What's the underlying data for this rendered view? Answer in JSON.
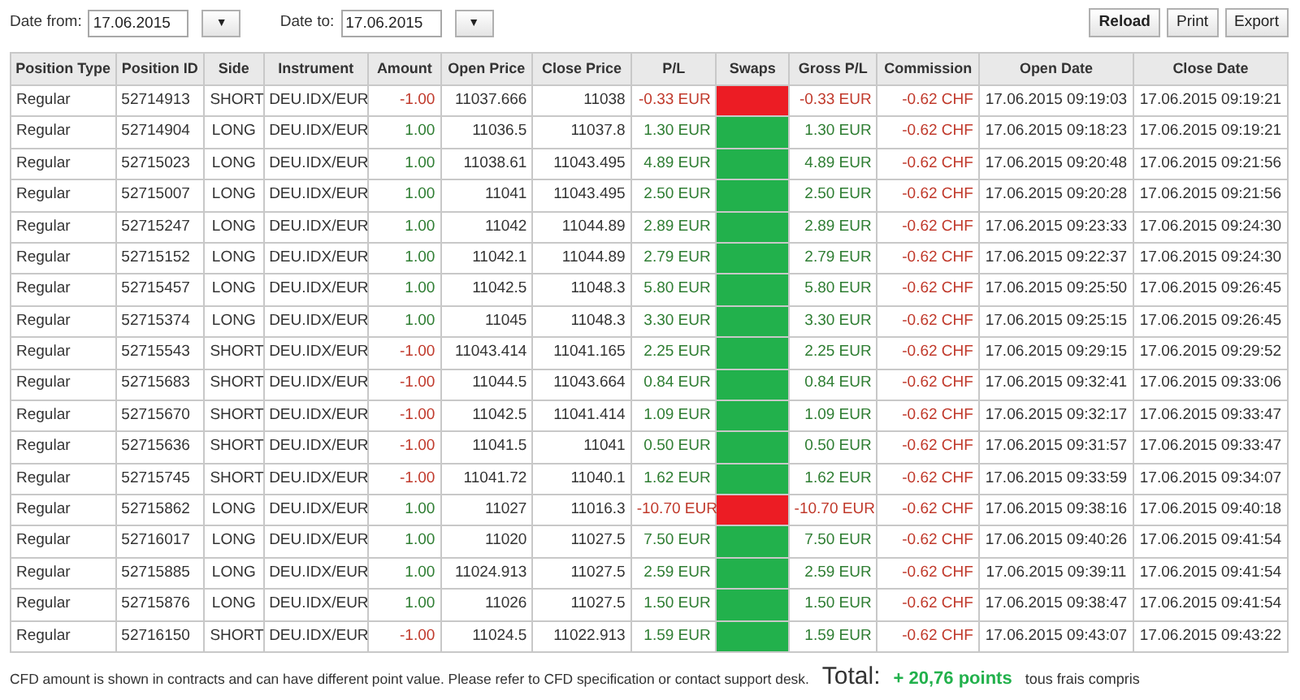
{
  "filters": [
    {
      "label": "Date from:",
      "value": "17.06.2015",
      "dropdown": "▼"
    },
    {
      "label": "Date to:",
      "value": "17.06.2015",
      "dropdown": "▼"
    }
  ],
  "buttons": [
    {
      "label": "Reload",
      "bold": true
    },
    {
      "label": "Print",
      "bold": false
    },
    {
      "label": "Export",
      "bold": false
    }
  ],
  "table": {
    "columns": [
      "Position Type",
      "Position ID",
      "Side",
      "Instrument",
      "Amount",
      "Open Price",
      "Close Price",
      "P/L",
      "Swaps",
      "Gross P/L",
      "Commission",
      "Open Date",
      "Close Date"
    ],
    "rows": [
      {
        "type": "Regular",
        "id": "52714913",
        "side": "SHORT",
        "instrument": "DEU.IDX/EUR",
        "amount": "-1.00",
        "amount_loss": true,
        "open_price": "11037.666",
        "close_price": "11038",
        "pl": "-0.33 EUR",
        "pl_loss": true,
        "color": "#ec1c24",
        "gross_pl": "-0.33 EUR",
        "commission": "-0.62 CHF",
        "open_date": "17.06.2015 09:19:03",
        "close_date": "17.06.2015 09:19:21"
      },
      {
        "type": "Regular",
        "id": "52714904",
        "side": "LONG",
        "instrument": "DEU.IDX/EUR",
        "amount": "1.00",
        "amount_loss": false,
        "open_price": "11036.5",
        "close_price": "11037.8",
        "pl": "1.30 EUR",
        "pl_loss": false,
        "color": "#22b14c",
        "gross_pl": "1.30 EUR",
        "commission": "-0.62 CHF",
        "open_date": "17.06.2015 09:18:23",
        "close_date": "17.06.2015 09:19:21"
      },
      {
        "type": "Regular",
        "id": "52715023",
        "side": "LONG",
        "instrument": "DEU.IDX/EUR",
        "amount": "1.00",
        "amount_loss": false,
        "open_price": "11038.61",
        "close_price": "11043.495",
        "pl": "4.89 EUR",
        "pl_loss": false,
        "color": "#22b14c",
        "gross_pl": "4.89 EUR",
        "commission": "-0.62 CHF",
        "open_date": "17.06.2015 09:20:48",
        "close_date": "17.06.2015 09:21:56"
      },
      {
        "type": "Regular",
        "id": "52715007",
        "side": "LONG",
        "instrument": "DEU.IDX/EUR",
        "amount": "1.00",
        "amount_loss": false,
        "open_price": "11041",
        "close_price": "11043.495",
        "pl": "2.50 EUR",
        "pl_loss": false,
        "color": "#22b14c",
        "gross_pl": "2.50 EUR",
        "commission": "-0.62 CHF",
        "open_date": "17.06.2015 09:20:28",
        "close_date": "17.06.2015 09:21:56"
      },
      {
        "type": "Regular",
        "id": "52715247",
        "side": "LONG",
        "instrument": "DEU.IDX/EUR",
        "amount": "1.00",
        "amount_loss": false,
        "open_price": "11042",
        "close_price": "11044.89",
        "pl": "2.89 EUR",
        "pl_loss": false,
        "color": "#22b14c",
        "gross_pl": "2.89 EUR",
        "commission": "-0.62 CHF",
        "open_date": "17.06.2015 09:23:33",
        "close_date": "17.06.2015 09:24:30"
      },
      {
        "type": "Regular",
        "id": "52715152",
        "side": "LONG",
        "instrument": "DEU.IDX/EUR",
        "amount": "1.00",
        "amount_loss": false,
        "open_price": "11042.1",
        "close_price": "11044.89",
        "pl": "2.79 EUR",
        "pl_loss": false,
        "color": "#22b14c",
        "gross_pl": "2.79 EUR",
        "commission": "-0.62 CHF",
        "open_date": "17.06.2015 09:22:37",
        "close_date": "17.06.2015 09:24:30"
      },
      {
        "type": "Regular",
        "id": "52715457",
        "side": "LONG",
        "instrument": "DEU.IDX/EUR",
        "amount": "1.00",
        "amount_loss": false,
        "open_price": "11042.5",
        "close_price": "11048.3",
        "pl": "5.80 EUR",
        "pl_loss": false,
        "color": "#22b14c",
        "gross_pl": "5.80 EUR",
        "commission": "-0.62 CHF",
        "open_date": "17.06.2015 09:25:50",
        "close_date": "17.06.2015 09:26:45"
      },
      {
        "type": "Regular",
        "id": "52715374",
        "side": "LONG",
        "instrument": "DEU.IDX/EUR",
        "amount": "1.00",
        "amount_loss": false,
        "open_price": "11045",
        "close_price": "11048.3",
        "pl": "3.30 EUR",
        "pl_loss": false,
        "color": "#22b14c",
        "gross_pl": "3.30 EUR",
        "commission": "-0.62 CHF",
        "open_date": "17.06.2015 09:25:15",
        "close_date": "17.06.2015 09:26:45"
      },
      {
        "type": "Regular",
        "id": "52715543",
        "side": "SHORT",
        "instrument": "DEU.IDX/EUR",
        "amount": "-1.00",
        "amount_loss": true,
        "open_price": "11043.414",
        "close_price": "11041.165",
        "pl": "2.25 EUR",
        "pl_loss": false,
        "color": "#22b14c",
        "gross_pl": "2.25 EUR",
        "commission": "-0.62 CHF",
        "open_date": "17.06.2015 09:29:15",
        "close_date": "17.06.2015 09:29:52"
      },
      {
        "type": "Regular",
        "id": "52715683",
        "side": "SHORT",
        "instrument": "DEU.IDX/EUR",
        "amount": "-1.00",
        "amount_loss": true,
        "open_price": "11044.5",
        "close_price": "11043.664",
        "pl": "0.84 EUR",
        "pl_loss": false,
        "color": "#22b14c",
        "gross_pl": "0.84 EUR",
        "commission": "-0.62 CHF",
        "open_date": "17.06.2015 09:32:41",
        "close_date": "17.06.2015 09:33:06"
      },
      {
        "type": "Regular",
        "id": "52715670",
        "side": "SHORT",
        "instrument": "DEU.IDX/EUR",
        "amount": "-1.00",
        "amount_loss": true,
        "open_price": "11042.5",
        "close_price": "11041.414",
        "pl": "1.09 EUR",
        "pl_loss": false,
        "color": "#22b14c",
        "gross_pl": "1.09 EUR",
        "commission": "-0.62 CHF",
        "open_date": "17.06.2015 09:32:17",
        "close_date": "17.06.2015 09:33:47"
      },
      {
        "type": "Regular",
        "id": "52715636",
        "side": "SHORT",
        "instrument": "DEU.IDX/EUR",
        "amount": "-1.00",
        "amount_loss": true,
        "open_price": "11041.5",
        "close_price": "11041",
        "pl": "0.50 EUR",
        "pl_loss": false,
        "color": "#22b14c",
        "gross_pl": "0.50 EUR",
        "commission": "-0.62 CHF",
        "open_date": "17.06.2015 09:31:57",
        "close_date": "17.06.2015 09:33:47"
      },
      {
        "type": "Regular",
        "id": "52715745",
        "side": "SHORT",
        "instrument": "DEU.IDX/EUR",
        "amount": "-1.00",
        "amount_loss": true,
        "open_price": "11041.72",
        "close_price": "11040.1",
        "pl": "1.62 EUR",
        "pl_loss": false,
        "color": "#22b14c",
        "gross_pl": "1.62 EUR",
        "commission": "-0.62 CHF",
        "open_date": "17.06.2015 09:33:59",
        "close_date": "17.06.2015 09:34:07"
      },
      {
        "type": "Regular",
        "id": "52715862",
        "side": "LONG",
        "instrument": "DEU.IDX/EUR",
        "amount": "1.00",
        "amount_loss": false,
        "open_price": "11027",
        "close_price": "11016.3",
        "pl": "-10.70 EUR",
        "pl_loss": true,
        "color": "#ec1c24",
        "gross_pl": "-10.70 EUR",
        "commission": "-0.62 CHF",
        "open_date": "17.06.2015 09:38:16",
        "close_date": "17.06.2015 09:40:18"
      },
      {
        "type": "Regular",
        "id": "52716017",
        "side": "LONG",
        "instrument": "DEU.IDX/EUR",
        "amount": "1.00",
        "amount_loss": false,
        "open_price": "11020",
        "close_price": "11027.5",
        "pl": "7.50 EUR",
        "pl_loss": false,
        "color": "#22b14c",
        "gross_pl": "7.50 EUR",
        "commission": "-0.62 CHF",
        "open_date": "17.06.2015 09:40:26",
        "close_date": "17.06.2015 09:41:54"
      },
      {
        "type": "Regular",
        "id": "52715885",
        "side": "LONG",
        "instrument": "DEU.IDX/EUR",
        "amount": "1.00",
        "amount_loss": false,
        "open_price": "11024.913",
        "close_price": "11027.5",
        "pl": "2.59 EUR",
        "pl_loss": false,
        "color": "#22b14c",
        "gross_pl": "2.59 EUR",
        "commission": "-0.62 CHF",
        "open_date": "17.06.2015 09:39:11",
        "close_date": "17.06.2015 09:41:54"
      },
      {
        "type": "Regular",
        "id": "52715876",
        "side": "LONG",
        "instrument": "DEU.IDX/EUR",
        "amount": "1.00",
        "amount_loss": false,
        "open_price": "11026",
        "close_price": "11027.5",
        "pl": "1.50 EUR",
        "pl_loss": false,
        "color": "#22b14c",
        "gross_pl": "1.50 EUR",
        "commission": "-0.62 CHF",
        "open_date": "17.06.2015 09:38:47",
        "close_date": "17.06.2015 09:41:54"
      },
      {
        "type": "Regular",
        "id": "52716150",
        "side": "SHORT",
        "instrument": "DEU.IDX/EUR",
        "amount": "-1.00",
        "amount_loss": true,
        "open_price": "11024.5",
        "close_price": "11022.913",
        "pl": "1.59 EUR",
        "pl_loss": false,
        "color": "#22b14c",
        "gross_pl": "1.59 EUR",
        "commission": "-0.62 CHF",
        "open_date": "17.06.2015 09:43:07",
        "close_date": "17.06.2015 09:43:22"
      }
    ]
  },
  "footer": {
    "note": "CFD amount is shown in contracts and can have different point value. Please refer to CFD specification or contact support desk.",
    "total_label": "Total:",
    "total_value": "+ 20,76 points",
    "total_suffix": "tous frais compris"
  }
}
